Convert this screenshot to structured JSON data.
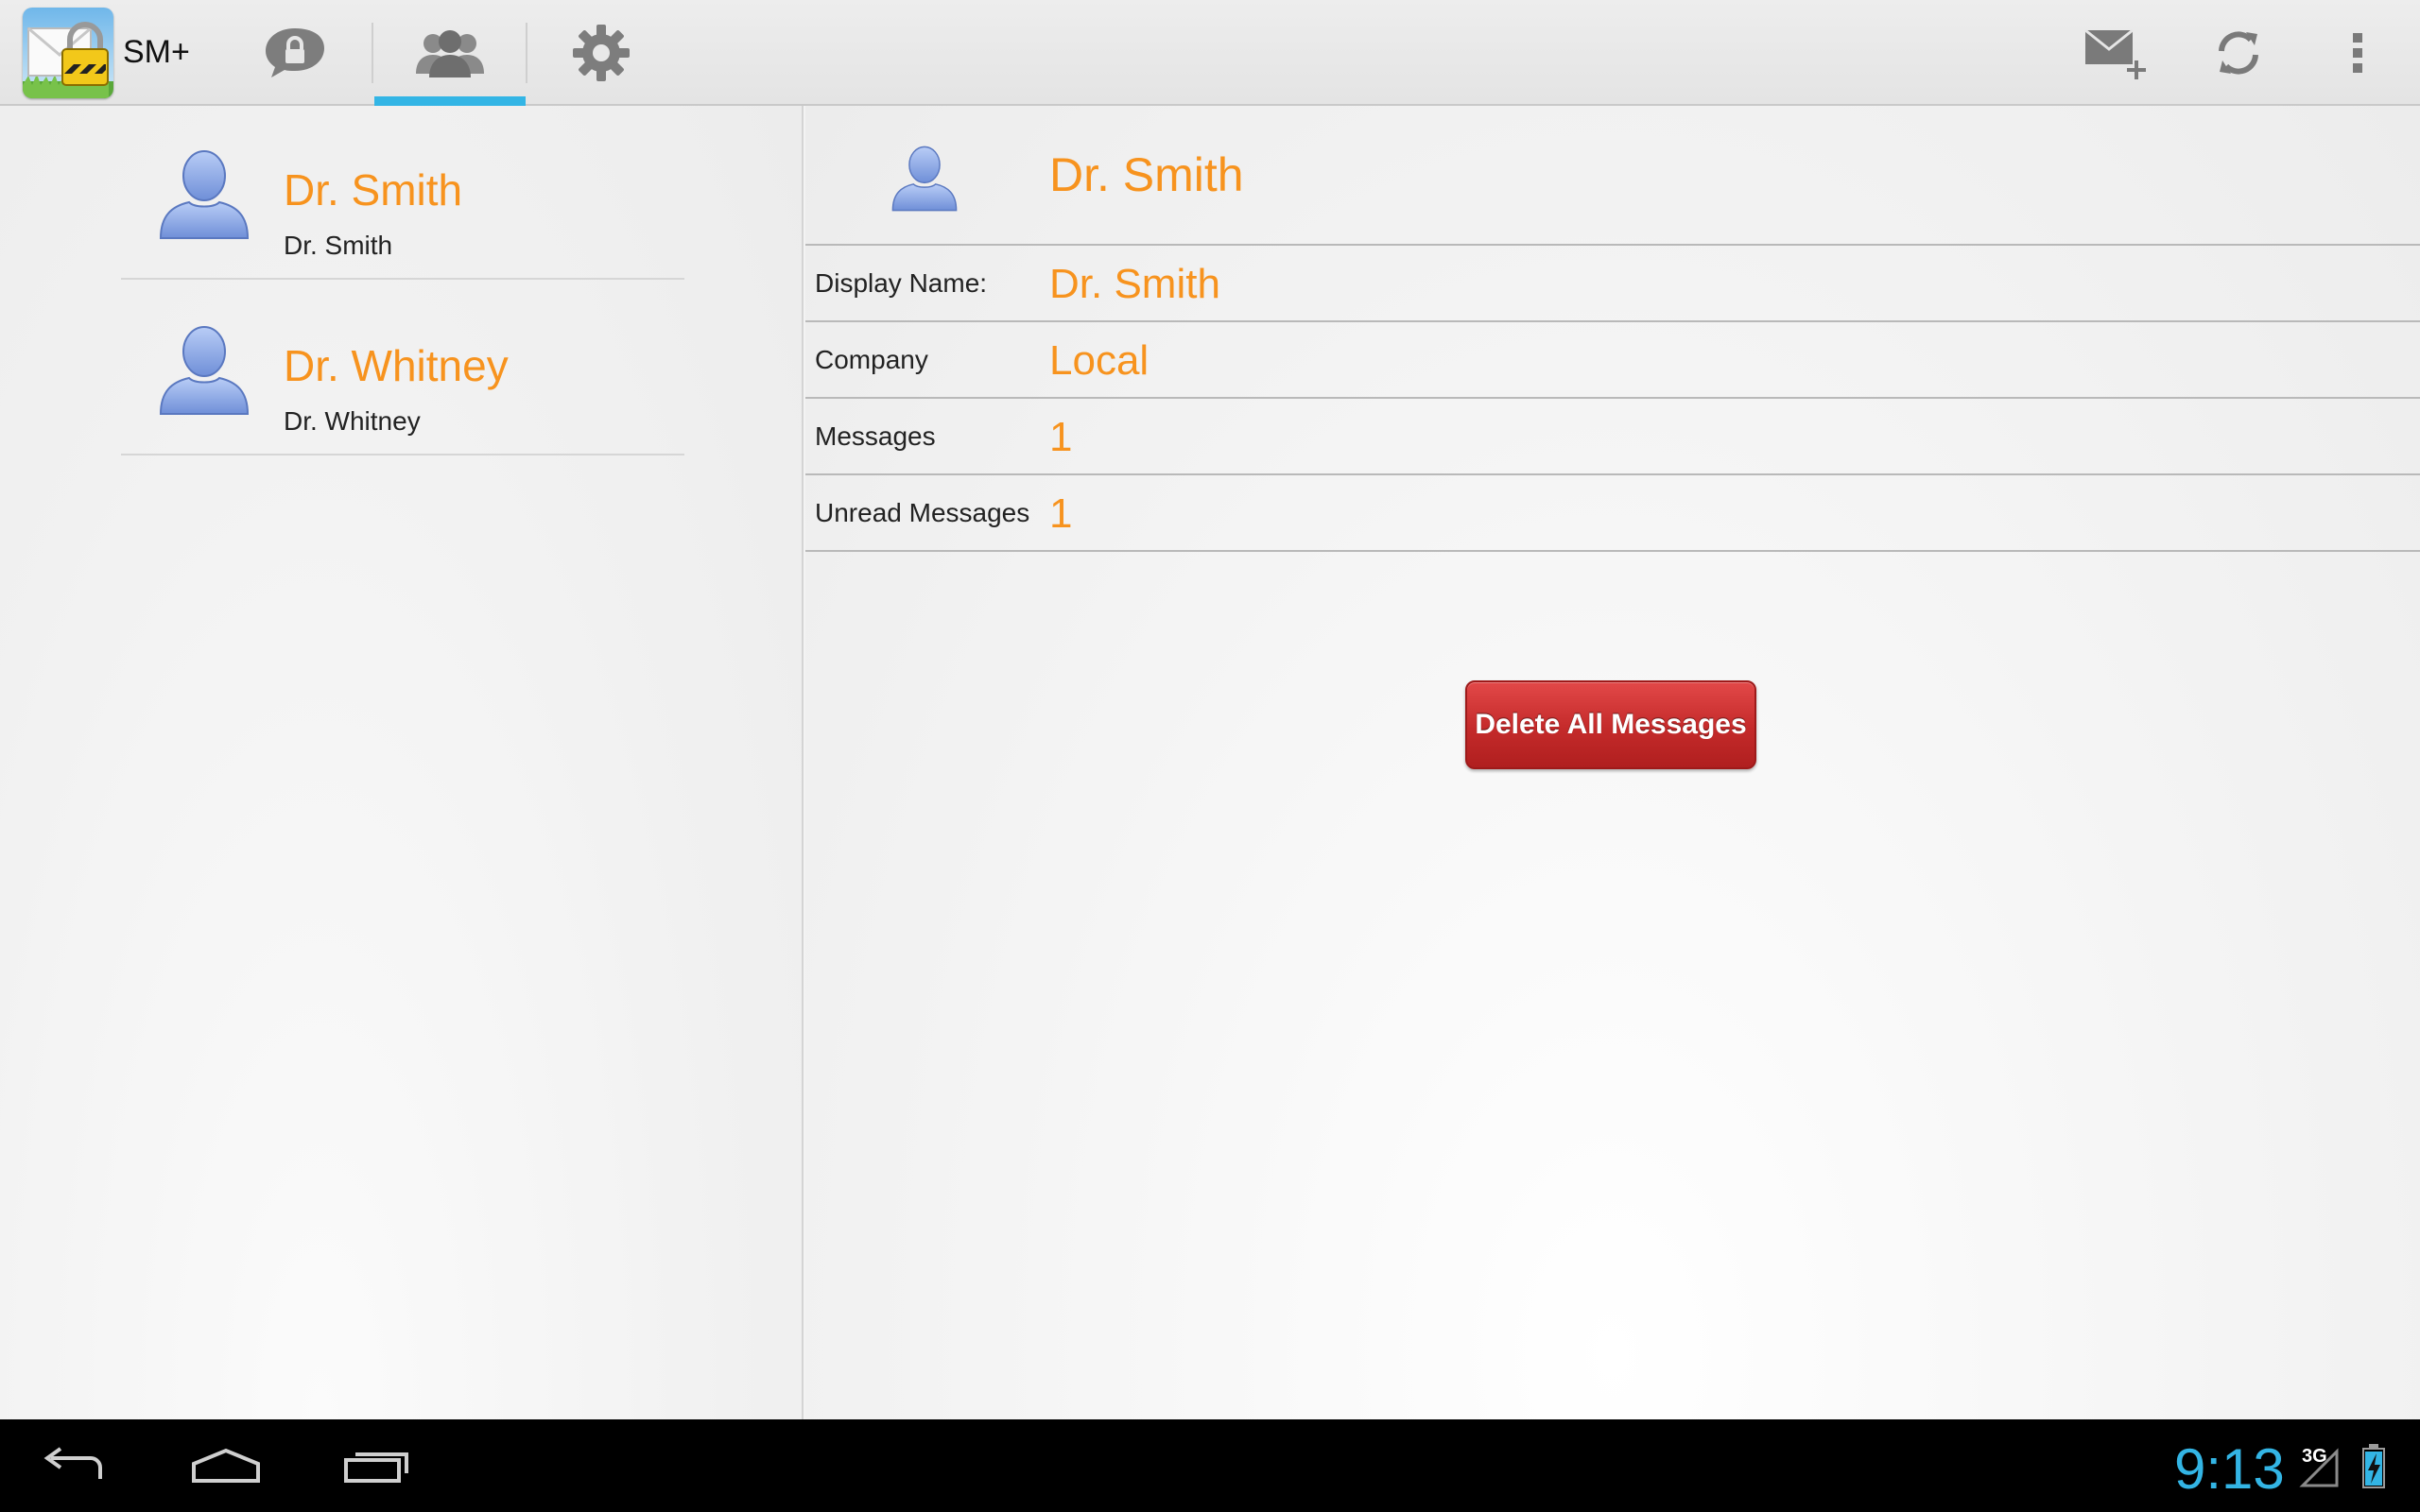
{
  "app": {
    "title": "SM+",
    "icon": "app-envelope-lock-icon"
  },
  "tabs": [
    {
      "name": "messages",
      "icon": "lock-speech-bubble-icon",
      "selected": false
    },
    {
      "name": "contacts",
      "icon": "contacts-icon",
      "selected": true
    },
    {
      "name": "settings",
      "icon": "gear-icon",
      "selected": false
    }
  ],
  "actions": [
    {
      "name": "new-message",
      "icon": "compose-mail-icon"
    },
    {
      "name": "refresh",
      "icon": "refresh-icon"
    },
    {
      "name": "overflow",
      "icon": "overflow-menu-icon"
    }
  ],
  "contacts": [
    {
      "name": "Dr. Smith",
      "subtitle": "Dr. Smith"
    },
    {
      "name": "Dr. Whitney",
      "subtitle": "Dr. Whitney"
    }
  ],
  "detail": {
    "name": "Dr. Smith",
    "rows": [
      {
        "label": "Display Name:",
        "value": "Dr. Smith"
      },
      {
        "label": "Company",
        "value": "Local"
      },
      {
        "label": "Messages",
        "value": "1"
      },
      {
        "label": "Unread Messages",
        "value": "1"
      }
    ],
    "delete_label": "Delete All Messages"
  },
  "status": {
    "time": "9:13",
    "network": "3G"
  },
  "colors": {
    "accent": "#33b5e5",
    "highlight_text": "#f7931e",
    "delete_button": "#c42a2a"
  }
}
